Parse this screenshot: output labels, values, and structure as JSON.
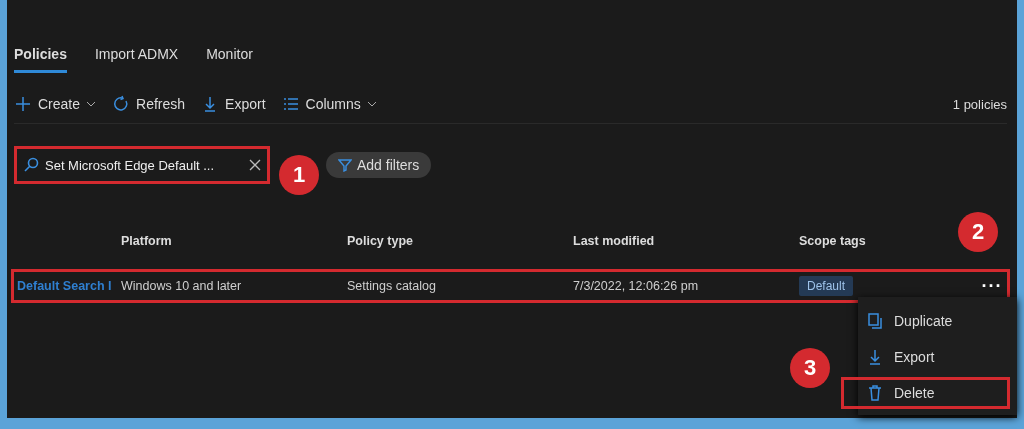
{
  "tabs": [
    {
      "label": "Policies",
      "selected": true
    },
    {
      "label": "Import ADMX",
      "selected": false
    },
    {
      "label": "Monitor",
      "selected": false
    }
  ],
  "toolbar": [
    {
      "kind": "create",
      "label": "Create",
      "dropdown": true
    },
    {
      "kind": "refresh",
      "label": "Refresh",
      "dropdown": false
    },
    {
      "kind": "export",
      "label": "Export",
      "dropdown": false
    },
    {
      "kind": "columns",
      "label": "Columns",
      "dropdown": true
    }
  ],
  "count": "1 policies",
  "search": {
    "value": "Set Microsoft Edge Default ...",
    "highlighted": true,
    "callout": "1"
  },
  "filter_button": "Add filters",
  "table": {
    "columns": [
      "Platform",
      "Policy type",
      "Last modified",
      "Scope tags"
    ],
    "callout": "2",
    "rows": [
      {
        "name": "Default Search I",
        "platform": "Windows 10 and later",
        "policy_type": "Settings catalog",
        "last_modified": "7/3/2022, 12:06:26 pm",
        "scope_tag": "Default",
        "more": "···",
        "highlighted": true
      }
    ]
  },
  "context_menu": {
    "callout": "3",
    "items": [
      {
        "kind": "duplicate",
        "label": "Duplicate",
        "highlighted": false
      },
      {
        "kind": "export",
        "label": "Export",
        "highlighted": false
      },
      {
        "kind": "delete",
        "label": "Delete",
        "highlighted": true
      }
    ]
  }
}
